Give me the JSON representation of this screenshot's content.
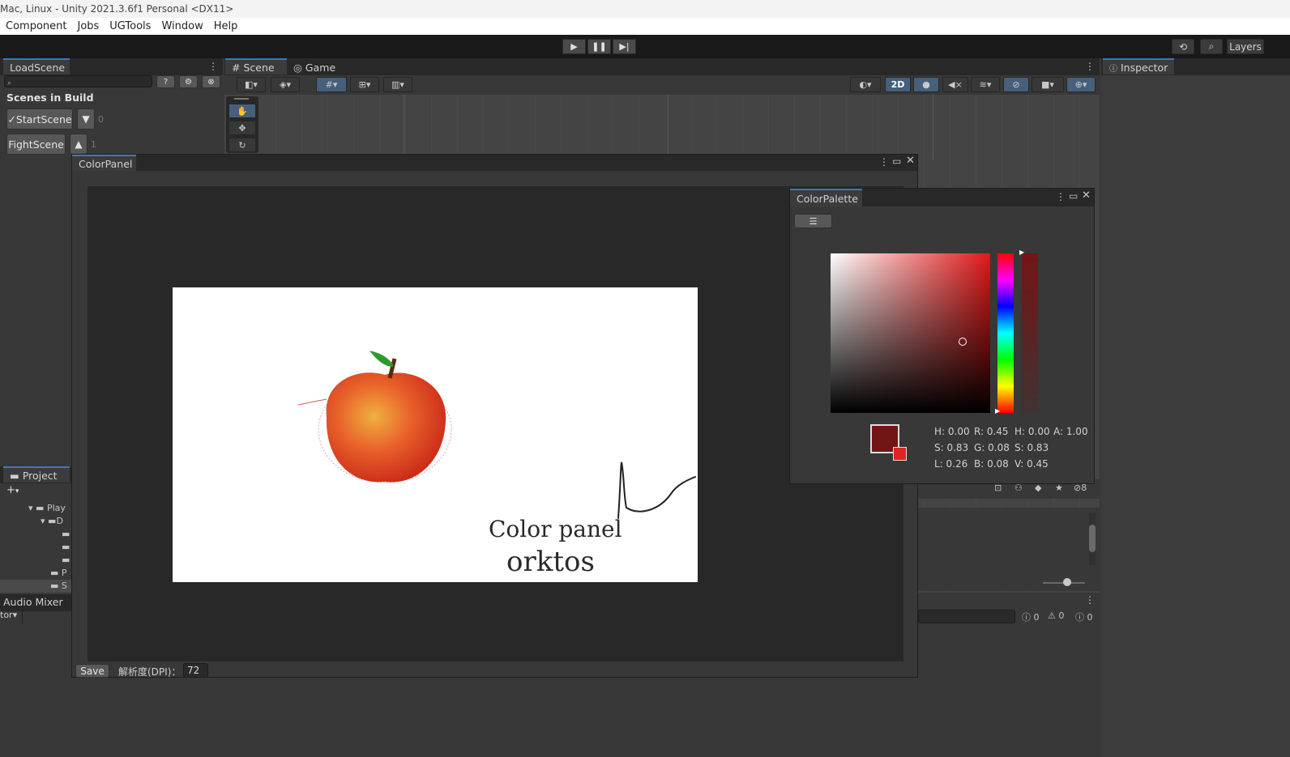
{
  "window": {
    "title": "Mac, Linux - Unity 2021.3.6f1 Personal <DX11>"
  },
  "menu": [
    "Component",
    "Jobs",
    "UGTools",
    "Window",
    "Help"
  ],
  "toolbar": {
    "layers_label": "Layers"
  },
  "load_scene": {
    "tab": "LoadScene",
    "header": "Scenes in Build",
    "scenes": [
      {
        "label": "✓StartScene",
        "index": "0"
      },
      {
        "label": "FightScene",
        "index": "1"
      }
    ]
  },
  "scene_view": {
    "tabs": [
      "Scene",
      "Game"
    ],
    "mode_2d": "2D"
  },
  "inspector": {
    "tab": "Inspector"
  },
  "project": {
    "tab": "Project",
    "items": [
      "Play",
      "D",
      "P",
      "S"
    ]
  },
  "audio_mixer": {
    "tab": "Audio Mixer",
    "dropdown": "tor"
  },
  "console": {
    "errors": "0",
    "warnings": "0",
    "infos": "0"
  },
  "hierarchy_count": "8",
  "color_panel": {
    "title": "ColorPanel",
    "save_label": "Save",
    "dpi_label": "解析度(DPI)：",
    "dpi_value": "72",
    "canvas_text_line1": "Color panel",
    "canvas_text_line2": "orktos"
  },
  "color_palette": {
    "title": "ColorPalette",
    "values": {
      "h1": "H: 0.00",
      "r": "R: 0.45",
      "h2": "H: 0.00",
      "a": "A: 1.00",
      "s1": "S: 0.83",
      "g": "G: 0.08",
      "s2": "S: 0.83",
      "l": "L: 0.26",
      "b": "B: 0.08",
      "v": "V: 0.45"
    },
    "current_color": "#731515",
    "previous_color": "#e02424"
  },
  "colors": {
    "accent": "#3a79bb",
    "panel": "#383838",
    "dark": "#282828"
  }
}
